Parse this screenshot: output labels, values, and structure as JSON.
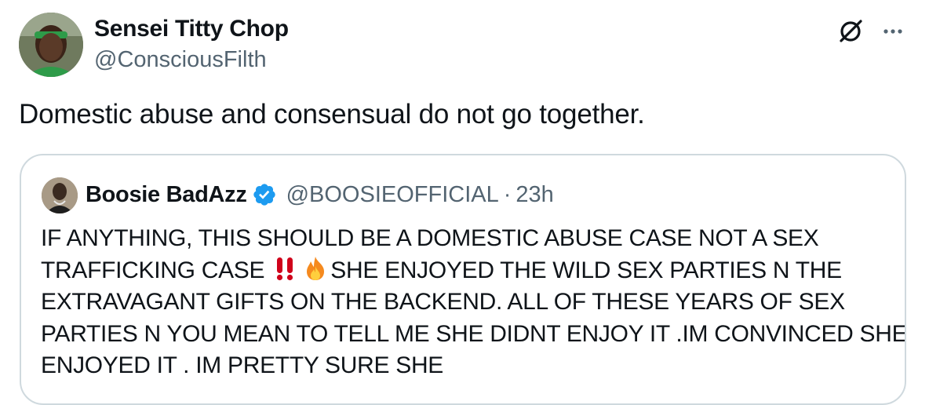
{
  "post": {
    "author_name": "Sensei Titty Chop",
    "author_handle": "@ConsciousFilth",
    "text": "Domestic abuse and consensual do not go together."
  },
  "quoted": {
    "author_name": "Boosie BadAzz",
    "author_handle": "@BOOSIEOFFICIAL",
    "separator": "·",
    "time": "23h",
    "lines": [
      {
        "before": "IF ANYTHING, THIS SHOULD BE A DOMESTIC ABUSE CASE NOT A SEX",
        "after": ""
      },
      {
        "before": "TRAFFICKING CASE ",
        "after": "SHE ENJOYED THE WILD SEX PARTIES N THE"
      },
      {
        "before": "EXTRAVAGANT GIFTS ON THE BACKEND. ALL OF THESE YEARS OF SEX",
        "after": ""
      },
      {
        "before": "PARTIES N YOU MEAN TO TELL ME SHE DIDNT ENJOY IT .IM CONVINCED SHE",
        "after": ""
      },
      {
        "before": "ENJOYED IT . IM PRETTY SURE SHE",
        "after": ""
      }
    ]
  },
  "icons": {
    "grok": "grok-icon",
    "more": "more-icon",
    "verified": "verified-badge-icon",
    "double_exclamation": "double-exclamation-emoji",
    "fire": "fire-emoji"
  },
  "colors": {
    "text": "#0f1419",
    "secondary": "#536471",
    "border": "#cfd9de",
    "verified": "#1d9bf0",
    "exclamation": "#d0021b"
  }
}
